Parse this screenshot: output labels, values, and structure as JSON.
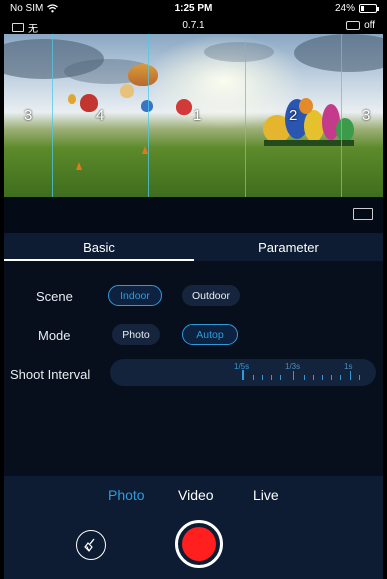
{
  "status_bar": {
    "carrier": "No SIM",
    "time": "1:25 PM",
    "battery_percent": "24%",
    "battery_level": 0.24,
    "wifi_icon": "wifi-icon"
  },
  "camera_info": {
    "camera_label": "无",
    "version": "0.7.1",
    "sd_status": "off"
  },
  "preview": {
    "grid_labels": [
      "3",
      "4",
      "1",
      "2",
      "3"
    ]
  },
  "tabs": {
    "basic": "Basic",
    "parameter": "Parameter",
    "active": "Basic"
  },
  "scene": {
    "label": "Scene",
    "options": [
      "Indoor",
      "Outdoor"
    ],
    "selected": "Indoor"
  },
  "mode": {
    "label": "Mode",
    "options": [
      "Photo",
      "Autop"
    ],
    "selected": "Autop"
  },
  "shoot_interval": {
    "label": "Shoot Interval",
    "values": [
      "1/5s",
      "1/3s",
      "1s"
    ],
    "selected": "1/5s"
  },
  "capture_modes": {
    "items": [
      "Photo",
      "Video",
      "Live"
    ],
    "active": "Photo"
  },
  "colors": {
    "accent": "#2f9bdc",
    "record": "#ff1f1f",
    "panel": "#0d1c33",
    "background": "#070e1c"
  }
}
